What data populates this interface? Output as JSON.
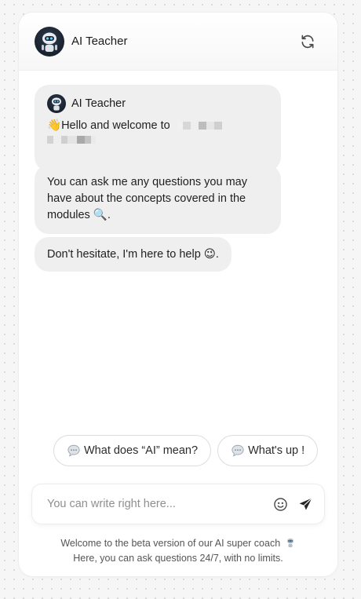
{
  "header": {
    "title": "AI Teacher"
  },
  "messages": [
    {
      "sender": "AI Teacher",
      "emoji": "👋",
      "text": "Hello and welcome to"
    },
    {
      "text": "You can ask me any questions you may have about the concepts covered in the modules",
      "trailing_emoji": "🔍",
      "end": "."
    },
    {
      "text": "Don't hesitate, I'm here to help",
      "trailing_emoji": "😉",
      "end": "."
    }
  ],
  "suggestions": [
    {
      "label": "What does “AI” mean?"
    },
    {
      "label": "What's up !"
    }
  ],
  "input": {
    "placeholder": "You can write right here..."
  },
  "footer": {
    "line1": "Welcome to the beta version of our AI super coach",
    "line2": "Here, you can ask questions 24/7, with no limits."
  },
  "icons": {
    "avatar": "robot-avatar-icon",
    "refresh": "refresh-icon",
    "chip": "speech-bubble-icon",
    "emoji": "smiley-icon",
    "send": "send-icon"
  }
}
